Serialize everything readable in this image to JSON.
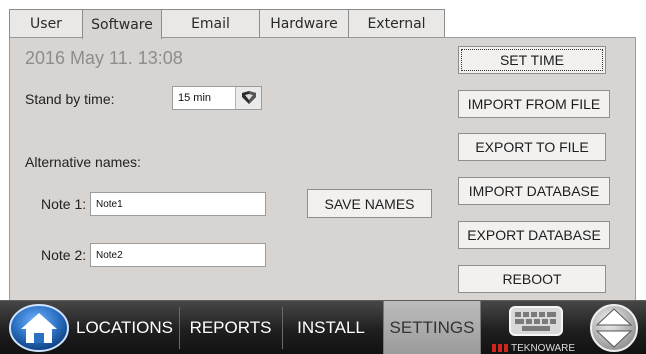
{
  "tabs": [
    "User",
    "Software",
    "Email",
    "Hardware",
    "External"
  ],
  "active_tab": "Software",
  "datetime": "2016 May 11. 13:08",
  "standby": {
    "label": "Stand by time:",
    "value": "15 min"
  },
  "alternative_names": {
    "label": "Alternative names:",
    "note1": {
      "label": "Note 1:",
      "value": "Note1"
    },
    "note2": {
      "label": "Note 2:",
      "value": "Note2"
    },
    "save_label": "SAVE NAMES"
  },
  "actions": {
    "set_time": "SET TIME",
    "import_file": "IMPORT FROM FILE",
    "export_file": "EXPORT TO FILE",
    "import_db": "IMPORT DATABASE",
    "export_db": "EXPORT DATABASE",
    "reboot": "REBOOT"
  },
  "nav": {
    "home_icon": "home-icon",
    "items": [
      "LOCATIONS",
      "REPORTS",
      "INSTALL",
      "SETTINGS"
    ],
    "active": "SETTINGS",
    "keyboard_icon": "keyboard-icon",
    "brand": "TEKNOWARE",
    "scroll_icon": "up-down-arrows-icon"
  },
  "colors": {
    "panel_bg": "#d7d4d2",
    "home_blue": "#2a6fc1",
    "brand_red": "#d0241e"
  }
}
